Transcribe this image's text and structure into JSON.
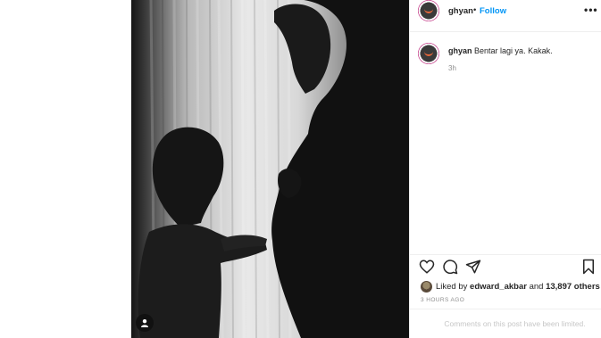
{
  "post": {
    "username": "ghyan",
    "separator": "•",
    "follow_label": "Follow",
    "more_label": "•••",
    "caption": "Bentar lagi ya. Kakak.",
    "caption_time": "3h",
    "liked_by_prefix": "Liked by",
    "liked_by_user": "edward_akbar",
    "liked_by_and": "and",
    "liked_by_others": "13,897 others",
    "posted_ago": "3 HOURS AGO",
    "comments_notice": "Comments on this post have been limited."
  },
  "icons": {
    "like": "heart-icon",
    "comment": "comment-icon",
    "share": "share-icon",
    "save": "bookmark-icon",
    "user_tag": "user-tag-icon",
    "more": "more-options-icon"
  },
  "colors": {
    "follow_blue": "#0095f6",
    "text": "#262626",
    "muted": "#8e8e8e",
    "border": "#efefef"
  }
}
